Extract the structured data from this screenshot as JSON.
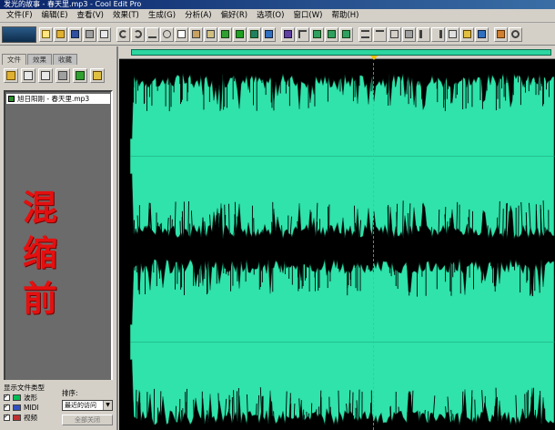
{
  "window": {
    "title": "发光的故事 - 春天里.mp3 - Cool Edit Pro"
  },
  "menu": {
    "items": [
      {
        "label": "文件(F)"
      },
      {
        "label": "编辑(E)"
      },
      {
        "label": "查看(V)"
      },
      {
        "label": "效果(T)"
      },
      {
        "label": "生成(G)"
      },
      {
        "label": "分析(A)"
      },
      {
        "label": "偏好(R)"
      },
      {
        "label": "选项(O)"
      },
      {
        "label": "窗口(W)"
      },
      {
        "label": "帮助(H)"
      }
    ]
  },
  "left_panel": {
    "tabs": [
      {
        "label": "文件",
        "active": true
      },
      {
        "label": "效果",
        "active": false
      },
      {
        "label": "收藏",
        "active": false
      }
    ],
    "files": [
      {
        "name": "旭日阳刚 - 春天里.mp3"
      }
    ],
    "overlay_text": [
      "混",
      "缩",
      "前"
    ],
    "display": {
      "section_label": "显示文件类型",
      "sort_label": "排序:",
      "types": [
        {
          "label": "波形",
          "checked": true,
          "color": "#00b050"
        },
        {
          "label": "MIDI",
          "checked": true,
          "color": "#3050c0"
        },
        {
          "label": "视频",
          "checked": true,
          "color": "#c03030"
        }
      ],
      "sort_value": "最近的访问",
      "action_button": "全部关闭"
    }
  },
  "colors": {
    "waveform": "#2fe3aa",
    "waveform_edge": "#0b3f2f",
    "background": "#000000",
    "overview_bar": "#2dd6a0",
    "cursor_marker": "#f0c000",
    "overlay_text": "#e41010"
  },
  "toolbar": {
    "icons": [
      "app-logo",
      "new-file",
      "open-file",
      "save",
      "save-as",
      "close",
      "undo",
      "redo",
      "repeat",
      "cut",
      "copy",
      "paste",
      "mix-paste",
      "loop",
      "record",
      "timing",
      "spectral",
      "waveform-view",
      "multitrack",
      "zoom-in",
      "zoom-out",
      "zoom-full",
      "zoom-selection",
      "zoom-left",
      "zoom-right",
      "normalize",
      "noise-reduction",
      "settings"
    ]
  }
}
